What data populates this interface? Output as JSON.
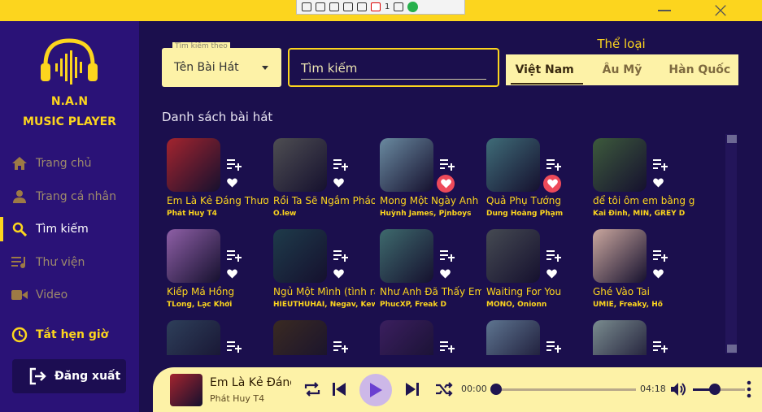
{
  "capture_toolbar": {
    "counter": "1"
  },
  "window": {
    "minimize_icon": "minimize-icon",
    "close_icon": "close-icon"
  },
  "brand": {
    "line1": "N.A.N",
    "line2": "MUSIC PLAYER"
  },
  "sidebar": {
    "items": [
      {
        "label": "Trang chủ",
        "icon": "home-icon"
      },
      {
        "label": "Trang cá nhân",
        "icon": "user-icon"
      },
      {
        "label": "Tìm kiếm",
        "icon": "search-icon",
        "active": true
      },
      {
        "label": "Thư viện",
        "icon": "library-icon"
      },
      {
        "label": "Video",
        "icon": "video-icon"
      },
      {
        "label": "Tắt hẹn giờ",
        "icon": "clock-icon"
      }
    ],
    "logout_label": "Đăng xuất"
  },
  "search": {
    "by_label": "Tìm kiếm theo",
    "by_value": "Tên Bài Hát",
    "placeholder": "Tìm kiếm"
  },
  "genre": {
    "title": "Thể loại",
    "tabs": [
      "Việt Nam",
      "Âu Mỹ",
      "Hàn Quốc"
    ],
    "active": "Việt Nam"
  },
  "list_title": "Danh sách bài hát",
  "songs": [
    {
      "title": "Em Là Kẻ Đáng Thương",
      "artist": "Phát Huy T4",
      "liked": false,
      "thumb": "#a3242e"
    },
    {
      "title": "Rồi Ta Sẽ Ngắm Pháo Hoa",
      "artist": "O.lew",
      "liked": false,
      "thumb": "#4e4e52"
    },
    {
      "title": "Mong Một Ngày Anh Nhớ Đến Em",
      "artist": "Huỳnh James, Pjnboys",
      "liked": true,
      "thumb": "#6a8aa0"
    },
    {
      "title": "Quả Phụ Tướng",
      "artist": "Dung Hoàng Phạm",
      "liked": true,
      "thumb": "#3f6c78"
    },
    {
      "title": "để tôi ôm em bằng giai điệu",
      "artist": "Kai Đinh, MIN, GREY D",
      "liked": false,
      "thumb": "#3d5a3c"
    },
    {
      "title": "Kiếp Má Hồng",
      "artist": "TLong, Lạc Khởi",
      "liked": false,
      "thumb": "#8e5fa6"
    },
    {
      "title": "Ngủ Một Mình (tình rất tình)",
      "artist": "HIEUTHUHAI, Negav, Kewtiie",
      "liked": false,
      "thumb": "#1e3b4a"
    },
    {
      "title": "Như Anh Đã Thấy Em",
      "artist": "PhucXP, Freak D",
      "liked": false,
      "thumb": "#3e6a6d"
    },
    {
      "title": "Waiting For You",
      "artist": "MONO, Onionn",
      "liked": false,
      "thumb": "#454a52"
    },
    {
      "title": "Ghé Vào Tai",
      "artist": "UMIE, Freaky, Hổ",
      "liked": false,
      "thumb": "#caa79e"
    },
    {
      "title": "",
      "artist": "",
      "liked": false,
      "thumb": "#2e3f5a"
    },
    {
      "title": "",
      "artist": "",
      "liked": false,
      "thumb": "#3a2a22"
    },
    {
      "title": "",
      "artist": "",
      "liked": false,
      "thumb": "#3b1f5f"
    },
    {
      "title": "",
      "artist": "",
      "liked": false,
      "thumb": "#5e7590"
    },
    {
      "title": "",
      "artist": "",
      "liked": false,
      "thumb": "#7a8c8f"
    }
  ],
  "player": {
    "title": "Em Là Kẻ Đáng Thương",
    "artist": "Phát Huy T4",
    "current_time": "00:00",
    "duration": "04:18",
    "progress": 0.0,
    "volume": 0.45,
    "thumb": "#a3242e"
  },
  "colors": {
    "accent": "#fcd51e",
    "background": "#1b0f4d",
    "sidebar": "#2a1277",
    "player": "#fdf2a7",
    "like": "#ee4a5a"
  }
}
